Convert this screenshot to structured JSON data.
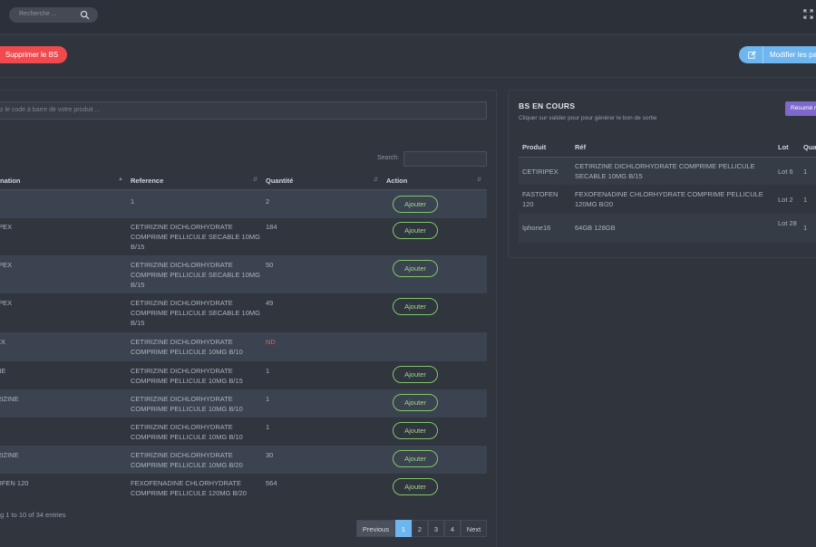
{
  "topbar": {
    "search_placeholder": "Recherche ...",
    "search_icon": "search-icon",
    "expand_icon": "expand-icon"
  },
  "actions": {
    "delete_label": "Supprimer le BS",
    "modify_label": "Modifier les pa"
  },
  "products": {
    "barcode_placeholder": "z le code à barre de votre produit ...",
    "search_label": "Search:",
    "columns": {
      "designation": "nation",
      "reference": "Reference",
      "quantite": "Quantité",
      "action": "Action"
    },
    "rows": [
      {
        "name": "",
        "ref": "1",
        "qty": "2",
        "action": "Ajouter"
      },
      {
        "name": "IPEX",
        "ref": "CETIRIZINE DICHLORHYDRATE COMPRIME PELLICULE SECABLE 10MG B/15",
        "qty": "184",
        "action": "Ajouter"
      },
      {
        "name": "IPEX",
        "ref": "CETIRIZINE DICHLORHYDRATE COMPRIME PELLICULE SECABLE 10MG B/15",
        "qty": "50",
        "action": "Ajouter"
      },
      {
        "name": "IPEX",
        "ref": "CETIRIZINE DICHLORHYDRATE COMPRIME PELLICULE SECABLE 10MG B/15",
        "qty": "49",
        "action": "Ajouter"
      },
      {
        "name": "EX",
        "ref": "CETIRIZINE DICHLORHYDRATE COMPRIME PELLICULE 10MG B/10",
        "qty": "ND",
        "action": ""
      },
      {
        "name": "NE",
        "ref": "CETIRIZINE DICHLORHYDRATE COMPRIME PELLICULE 10MG B/15",
        "qty": "1",
        "action": "Ajouter"
      },
      {
        "name": "RIZINE",
        "ref": "CETIRIZINE DICHLORHYDRATE COMPRIME PELLICULE 10MG B/10",
        "qty": "1",
        "action": "Ajouter"
      },
      {
        "name": "",
        "ref": "CETIRIZINE DICHLORHYDRATE COMPRIME PELLICULE 10MG B/10",
        "qty": "1",
        "action": "Ajouter"
      },
      {
        "name": "RIZINE",
        "ref": "CETIRIZINE DICHLORHYDRATE COMPRIME PELLICULE 10MG B/20",
        "qty": "30",
        "action": "Ajouter"
      },
      {
        "name": "OFEN 120",
        "ref": "FEXOFENADINE CHLORHYDRATE COMPRIME PELLICULE 120MG B/20",
        "qty": "564",
        "action": "Ajouter"
      }
    ],
    "entries_info": "g 1 to 10 of 34 entries",
    "pagination": {
      "previous": "Previous",
      "pages": [
        "1",
        "2",
        "3",
        "4"
      ],
      "next": "Next",
      "active": "1"
    }
  },
  "bs_en_cours": {
    "title": "BS EN COURS",
    "subtitle": "Cliquer sur valider pour pour générer le bon de sortie",
    "summary_button": "Résumé r",
    "columns": {
      "produit": "Produit",
      "ref": "Réf",
      "lot": "Lot",
      "qty": "Qua"
    },
    "rows": [
      {
        "produit": "CETIRIPEX",
        "ref": "CETIRIZINE DICHLORHYDRATE COMPRIME PELLICULE SECABLE 10MG B/15",
        "lot": "Lot 6",
        "qty": "1"
      },
      {
        "produit": "FASTOFEN 120",
        "ref": "FEXOFENADINE CHLORHYDRATE COMPRIME PELLICULE 120MG B/20",
        "lot": "Lot 2",
        "qty": "1"
      },
      {
        "produit": "Iphone16",
        "ref": "64GB 128GB",
        "lot": "Lot 28",
        "qty": "1"
      }
    ]
  },
  "colors": {
    "background": "#2f343d",
    "danger": "#f0494e",
    "info": "#6eb6f0",
    "success": "#7fc76a",
    "purple": "#7d68cc",
    "row_stripe": "#3b4350",
    "nd": "#e35a5f"
  }
}
